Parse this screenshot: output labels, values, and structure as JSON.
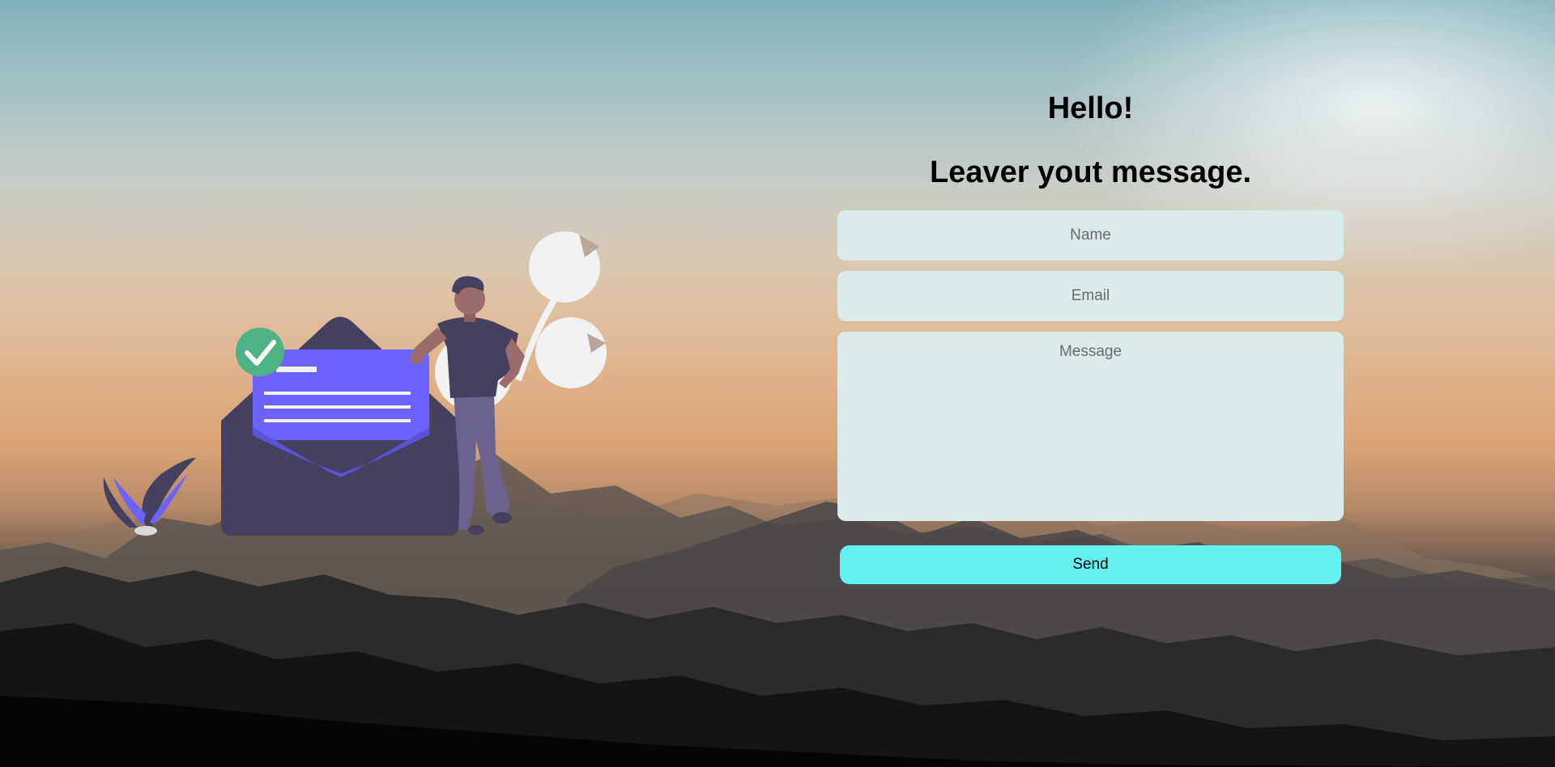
{
  "contact": {
    "greeting": "Hello!",
    "subtitle": "Leaver yout message.",
    "name_placeholder": "Name",
    "email_placeholder": "Email",
    "message_placeholder": "Message",
    "send_label": "Send"
  },
  "colors": {
    "field_background": "#d9ebea",
    "send_button": "#62f1ef",
    "envelope_dark": "#45405e",
    "letter_purple": "#6c63ff",
    "check_green": "#4fb286"
  },
  "icons": [
    "checkmark-icon",
    "envelope-illustration",
    "person-illustration",
    "plant-illustration",
    "speech-bubble-illustration"
  ]
}
